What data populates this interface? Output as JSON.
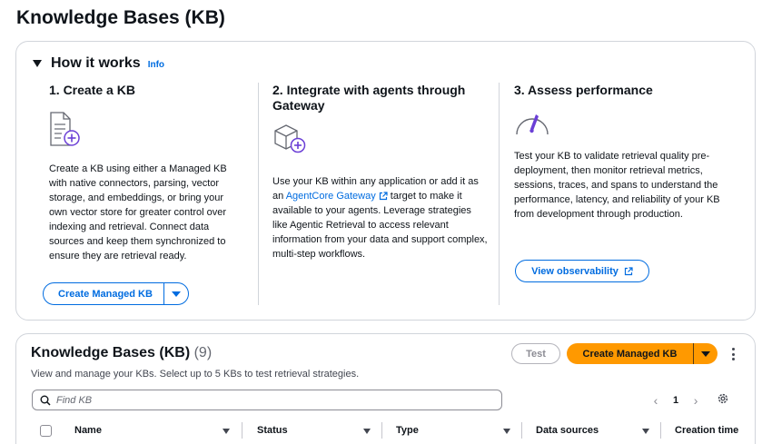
{
  "page_title": "Knowledge Bases (KB)",
  "how_it_works": {
    "title": "How it works",
    "info": "Info",
    "steps": [
      {
        "heading": "1. Create a KB",
        "icon": "document-add-icon",
        "text": "Create a KB using either a Managed KB with native connectors, parsing, vector storage, and embeddings, or bring your own vector store for greater control over indexing and retrieval. Connect data sources and keep them synchronized to ensure they are retrieval ready.",
        "button": "Create Managed KB"
      },
      {
        "heading": "2. Integrate with agents through Gateway",
        "icon": "cube-add-icon",
        "text_before": "Use your KB within any application or add it as an ",
        "link": "AgentCore Gateway",
        "text_after": " target to make it available to your agents. Leverage strategies like Agentic Retrieval to access relevant information from your data and support complex, multi-step workflows."
      },
      {
        "heading": "3. Assess performance",
        "icon": "gauge-icon",
        "text": "Test your KB to validate retrieval quality pre-deployment, then monitor retrieval metrics, sessions, traces, and spans to understand the performance, latency, and reliability of your KB from development through production.",
        "button": "View observability"
      }
    ]
  },
  "kb_table": {
    "title": "Knowledge Bases (KB)",
    "count": "(9)",
    "description": "View and manage your KBs. Select up to 5 KBs to test retrieval strategies.",
    "test_button": "Test",
    "create_button": "Create Managed KB",
    "search_placeholder": "Find KB",
    "page": "1",
    "columns": [
      "Name",
      "Status",
      "Type",
      "Data sources",
      "Creation time"
    ]
  },
  "colors": {
    "accent": "#006ce0",
    "primary_button": "#ff9900",
    "icon_purple": "#6b3fd6"
  }
}
